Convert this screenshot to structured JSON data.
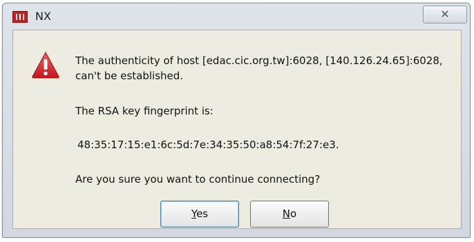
{
  "window": {
    "title": "NX",
    "close_glyph": "✕",
    "app_icon": "nx-app-icon"
  },
  "dialog": {
    "warning_icon": "warning-triangle-icon",
    "message_line1": "The authenticity of host [edac.cic.org.tw]:6028, [140.126.24.65]:6028,",
    "message_line2": "can't be established.",
    "fingerprint_label": "The RSA key fingerprint is:",
    "fingerprint_value": "48:35:17:15:e1:6c:5d:7e:34:35:50:a8:54:7f:27:e3.",
    "question": "Are you sure you want to continue connecting?"
  },
  "buttons": {
    "yes": {
      "mnemonic": "Y",
      "rest": "es"
    },
    "no": {
      "mnemonic": "N",
      "rest": "o"
    }
  },
  "colors": {
    "dialog_background": "#eeece1",
    "warning_red": "#d9232a",
    "default_button_border": "#3c7fb1"
  }
}
